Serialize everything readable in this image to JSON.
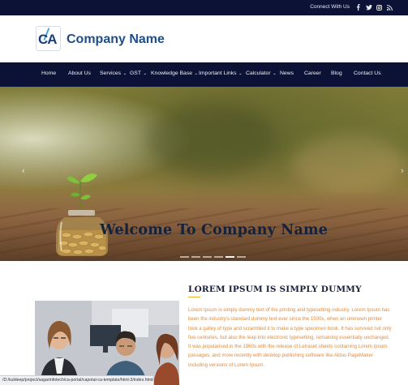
{
  "topbar": {
    "connect_label": "Connect With Us",
    "social_icons": [
      "facebook-icon",
      "twitter-icon",
      "instagram-icon",
      "rss-icon"
    ]
  },
  "header": {
    "logo_text": "CA",
    "company_name": "Company Name"
  },
  "nav": {
    "items": [
      {
        "label": "Home",
        "has_dropdown": false
      },
      {
        "label": "About Us",
        "has_dropdown": false
      },
      {
        "label": "Services",
        "has_dropdown": true
      },
      {
        "label": "GST",
        "has_dropdown": true
      },
      {
        "label": "Knowledge Base",
        "has_dropdown": true
      },
      {
        "label": "Important Links",
        "has_dropdown": true
      },
      {
        "label": "Calculator",
        "has_dropdown": true
      },
      {
        "label": "News",
        "has_dropdown": false
      },
      {
        "label": "Career",
        "has_dropdown": false
      },
      {
        "label": "Blog",
        "has_dropdown": false
      },
      {
        "label": "Contact Us",
        "has_dropdown": false
      }
    ]
  },
  "hero": {
    "title": "Welcome To Company Name",
    "prev_icon": "chevron-left-icon",
    "next_icon": "chevron-right-icon",
    "slide_count": 6,
    "active_slide": 5
  },
  "about": {
    "title": "LOREM IPSUM IS SIMPLY DUMMY",
    "body": "Lorem Ipsum is simply dummy text of the printing and typesetting industry. Lorem Ipsum has been the industry's standard dummy text ever since the 1500s, when an unknown printer took a galley of type and scrambled it to make a type specimen book. It has survived not only five centuries, but also the leap into electronic typesetting, remaining essentially unchanged. It was popularised in the 1960s with the release of Letraset sheets containing Lorem Ipsum passages, and more recently with desktop publishing software like Aldus PageMaker including versions of Lorem Ipsum."
  },
  "statusbar": {
    "url": "/D:/kuldeep/project/sagarinfotech/ca-portal/capotal-ca-template/html-3/index.html#demo"
  },
  "colors": {
    "navy": "#0b1236",
    "brand_blue": "#1e4e8c",
    "accent_gold": "#f2b134",
    "body_text": "#e08c3f"
  }
}
